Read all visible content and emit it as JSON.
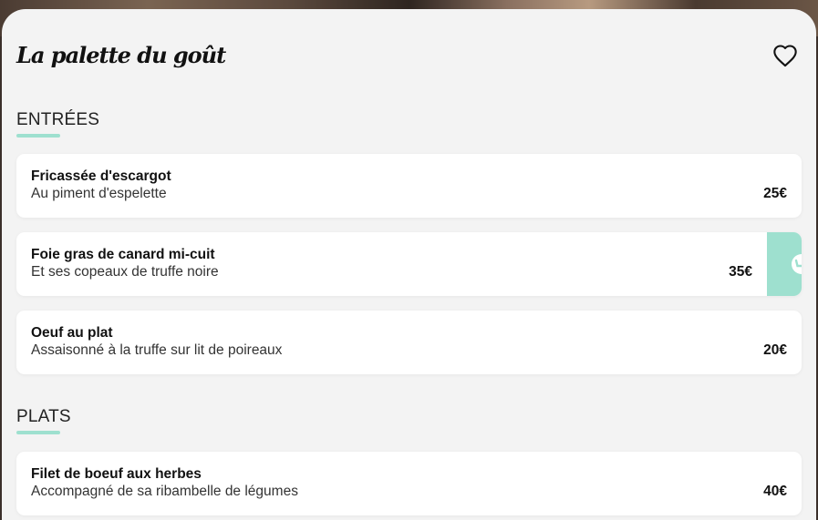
{
  "restaurant": {
    "title": "La palette du goût"
  },
  "icons": {
    "favorite": "heart-outline-icon",
    "swipe_action": "clock-icon"
  },
  "colors": {
    "accent": "#9ee0cf",
    "background": "#f3f3f3",
    "card": "#ffffff"
  },
  "sections": [
    {
      "title": "ENTRÉES",
      "items": [
        {
          "name": "Fricassée d'escargot",
          "description": "Au piment d'espelette",
          "price": "25€"
        },
        {
          "name": "Foie gras de canard mi-cuit",
          "description": "Et ses copeaux de truffe noire",
          "price": "35€"
        },
        {
          "name": "Oeuf au plat",
          "description": "Assaisonné à la truffe sur lit de poireaux",
          "price": "20€"
        }
      ]
    },
    {
      "title": "PLATS",
      "items": [
        {
          "name": "Filet de boeuf aux herbes",
          "description": "Accompagné de sa ribambelle de légumes",
          "price": "40€"
        }
      ]
    }
  ]
}
